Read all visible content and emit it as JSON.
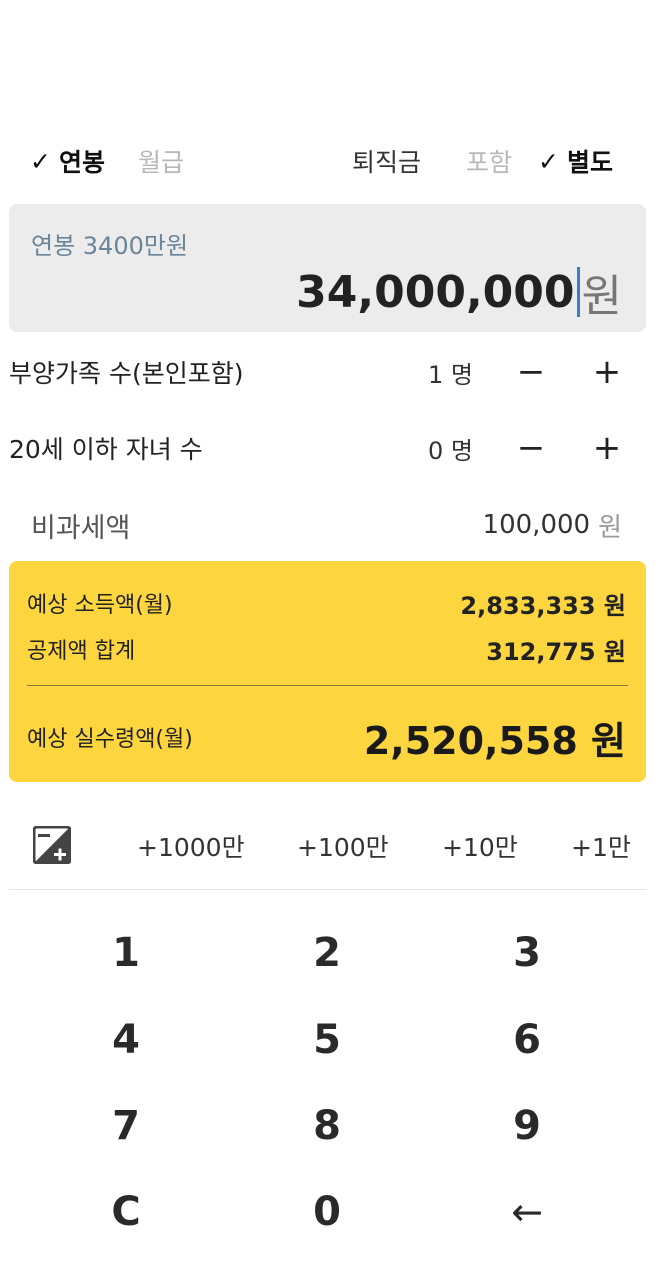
{
  "mode": {
    "annual_check": "✓",
    "annual": "연봉",
    "monthly": "월급",
    "severance_label": "퇴직금",
    "included": "포함",
    "separate_check": "✓",
    "separate": "별도"
  },
  "salary": {
    "caption": "연봉 3400만원",
    "value": "34,000,000",
    "unit": "원"
  },
  "dependents": {
    "label": "부양가족 수(본인포함)",
    "value": "1 명",
    "minus": "−",
    "plus": "+"
  },
  "children": {
    "label": "20세 이하 자녀 수",
    "value": "0 명",
    "minus": "−",
    "plus": "+"
  },
  "tax_free": {
    "label": "비과세액",
    "value": "100,000",
    "unit": "원"
  },
  "result": {
    "income_label": "예상 소득액(월)",
    "income_value": "2,833,333 원",
    "deduction_label": "공제액 합계",
    "deduction_value": "312,775 원",
    "net_label": "예상 실수령액(월)",
    "net_value": "2,520,558 원",
    "accent_color": "#fdd63f"
  },
  "quick_add": {
    "icon": "calculator-plus-minus-icon",
    "b1": "+1000만",
    "b2": "+100만",
    "b3": "+10만",
    "b4": "+1만"
  },
  "keypad": {
    "k1": "1",
    "k2": "2",
    "k3": "3",
    "k4": "4",
    "k5": "5",
    "k6": "6",
    "k7": "7",
    "k8": "8",
    "k9": "9",
    "kc": "C",
    "k0": "0",
    "kback": "←"
  }
}
